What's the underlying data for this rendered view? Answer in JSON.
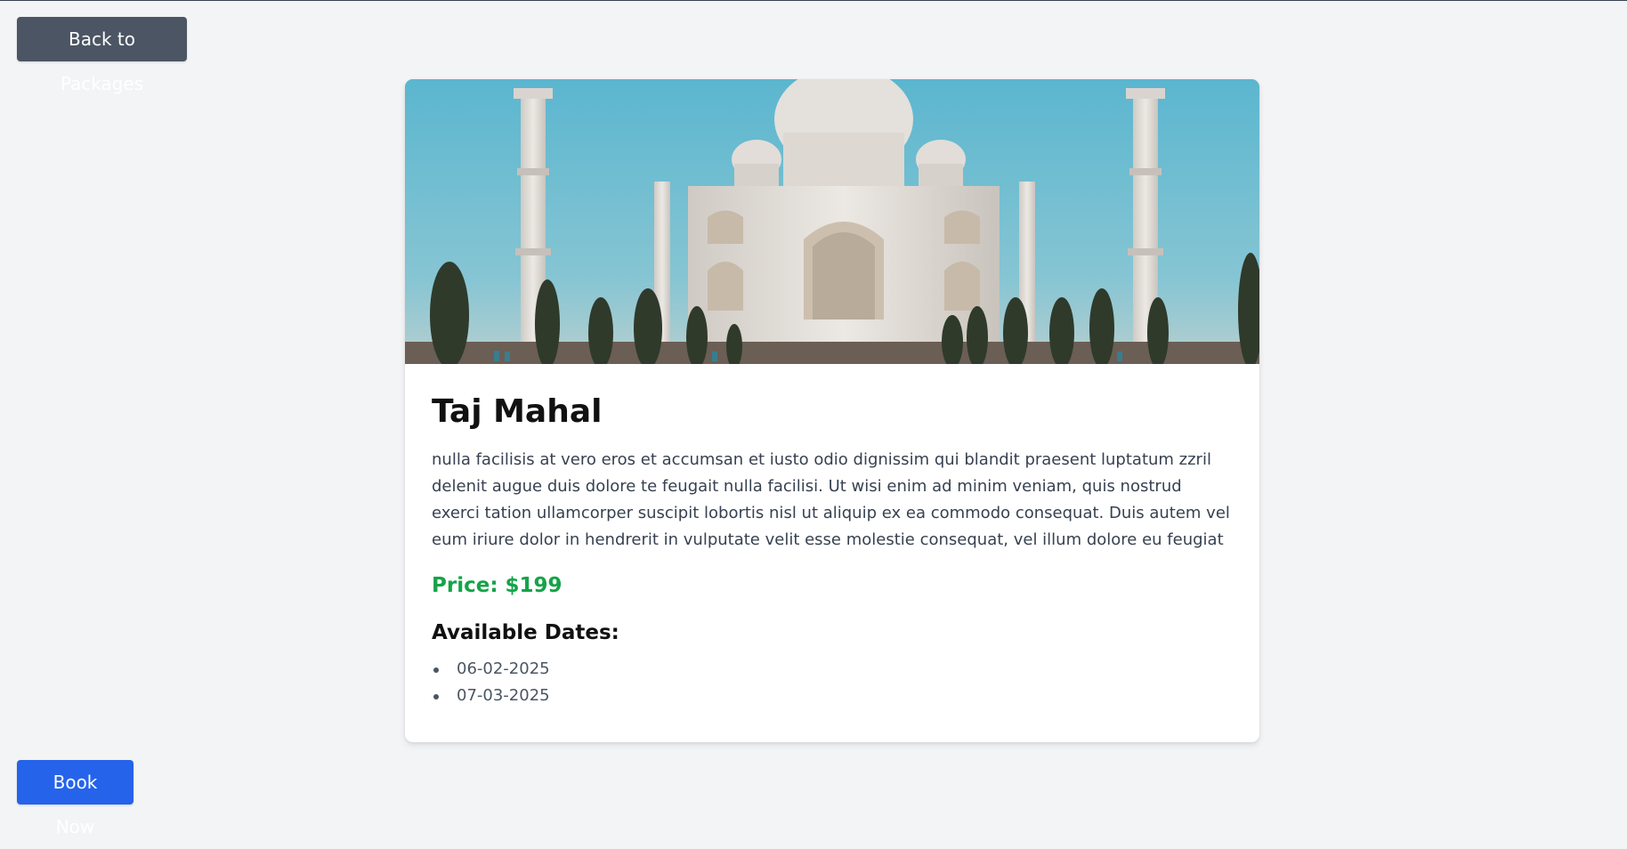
{
  "nav": {
    "back_label": "Back to Packages"
  },
  "package": {
    "image_subject": "Taj Mahal photo",
    "title": "Taj Mahal",
    "description": "nulla facilisis at vero eros et accumsan et iusto odio dignissim qui blandit praesent luptatum zzril delenit augue duis dolore te feugait nulla facilisi. Ut wisi enim ad minim veniam, quis nostrud exerci tation ullamcorper suscipit lobortis nisl ut aliquip ex ea commodo consequat. Duis autem vel eum iriure dolor in hendrerit in vulputate velit esse molestie consequat, vel illum dolore eu feugiat",
    "price_label": "Price: $199",
    "dates_heading": "Available Dates:",
    "dates": [
      "06-02-2025",
      "07-03-2025"
    ]
  },
  "actions": {
    "book_label": "Book Now"
  },
  "colors": {
    "back_button": "#4b5563",
    "book_button": "#2563eb",
    "price": "#16a34a",
    "page_background": "#f3f4f6"
  }
}
